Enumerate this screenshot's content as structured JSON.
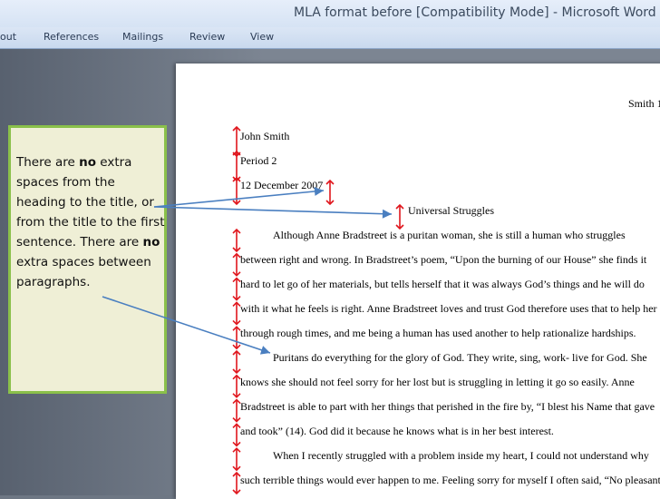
{
  "window": {
    "title": "MLA format before [Compatibility Mode]  -  Microsoft Word"
  },
  "ribbon": {
    "tabs": [
      "out",
      "References",
      "Mailings",
      "Review",
      "View"
    ]
  },
  "document": {
    "header_right": "Smith 1",
    "heading": [
      "John Smith",
      "Period 2",
      "12 December 2007"
    ],
    "title": "Universal Struggles",
    "lines": [
      "Although Anne Bradstreet is a puritan woman, she is still a human who struggles",
      "between right and wrong. In Bradstreet’s poem, “Upon the burning of our House” she finds it",
      "hard to let go of her materials, but tells herself that it was always God’s things and he will do",
      "with it what he feels is right. Anne Bradstreet loves and trust God therefore uses that to help her",
      "through rough times, and me being a human has used another to help rationalize hardships.",
      "Puritans do everything for the glory of God. They write, sing, work- live for God. She",
      "knows she should not feel sorry for her lost but is struggling in letting it go so easily. Anne",
      "Bradstreet is able to part with her things that perished in the fire by, “I blest his Name that gave",
      "and took” (14).  God did it because he knows what is in her best interest.",
      "When I recently struggled with a problem inside my heart, I could not understand why",
      "such terrible things would ever happen to me. Feeling sorry for myself I often said, “No pleasant"
    ]
  },
  "callout": {
    "segments": [
      {
        "text": "There are ",
        "bold": false
      },
      {
        "text": "no",
        "bold": true
      },
      {
        "text": " extra spaces from the heading to the title, or from the title to the first sentence. There are ",
        "bold": false
      },
      {
        "text": "no",
        "bold": true
      },
      {
        "text": " extra spaces between paragraphs.",
        "bold": false
      }
    ]
  },
  "colors": {
    "spacing_arrow": "#e0161d",
    "pointer_arrow": "#4a7fc0",
    "callout_border": "#8ac04a"
  }
}
